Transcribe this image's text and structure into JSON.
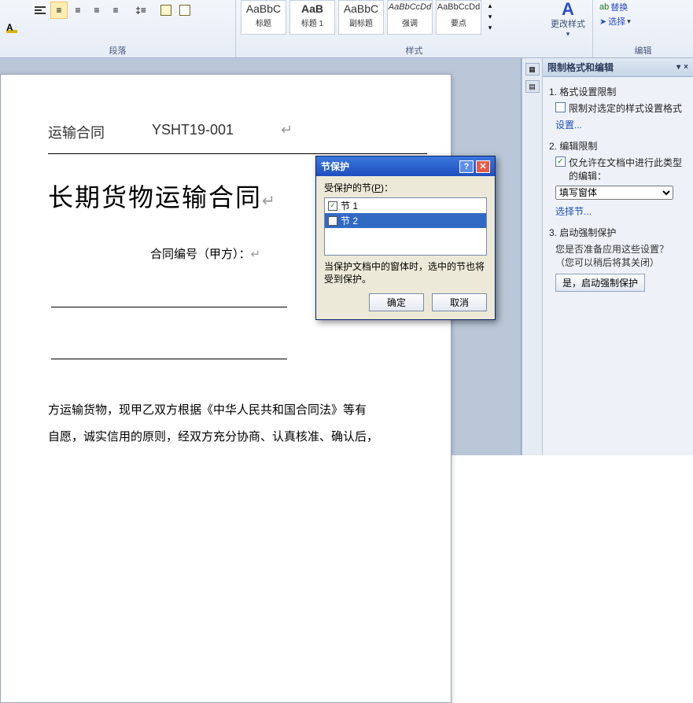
{
  "ribbon": {
    "paragraph_label": "段落",
    "styles_label": "样式",
    "edit_label": "编辑",
    "style_cards": [
      {
        "preview": "AaBbC",
        "name": "标题"
      },
      {
        "preview": "AaB",
        "name": "标题 1"
      },
      {
        "preview": "AaBbC",
        "name": "副标题"
      },
      {
        "preview": "AaBbCcDd",
        "name": "强调"
      },
      {
        "preview": "AaBbCcDd",
        "name": "要点"
      }
    ],
    "change_style": "更改样式",
    "edit_replace": "替换",
    "edit_select": "选择"
  },
  "document": {
    "header_left": "运输合同",
    "header_right": "YSHT19-001",
    "title": "长期货物运输合同",
    "subtitle": "合同编号（甲方）：",
    "body_line1": "方运输货物，现甲乙双方根据《中华人民共和国合同法》等有",
    "body_line2": "自愿，诚实信用的原则，经双方充分协商、认真核准、确认后，"
  },
  "task_pane": {
    "title": "限制格式和编辑",
    "sec1": "1.  格式设置限制",
    "sec1_chk": "限制对选定的样式设置格式",
    "sec1_link": "设置...",
    "sec2": "2.  编辑限制",
    "sec2_chk": "仅允许在文档中进行此类型的编辑：",
    "sec2_select": "填写窗体",
    "sec2_link": "选择节...",
    "sec3": "3.  启动强制保护",
    "sec3_note": "您是否准备应用这些设置？（您可以稍后将其关闭）",
    "sec3_btn": "是，启动强制保护"
  },
  "dialog": {
    "title": "节保护",
    "label_pre": "受保护的节(",
    "label_u": "P",
    "label_post": ")：",
    "item1": "节 1",
    "item2": "节 2",
    "note": "当保护文档中的窗体时，选中的节也将受到保护。",
    "ok": "确定",
    "cancel": "取消"
  }
}
